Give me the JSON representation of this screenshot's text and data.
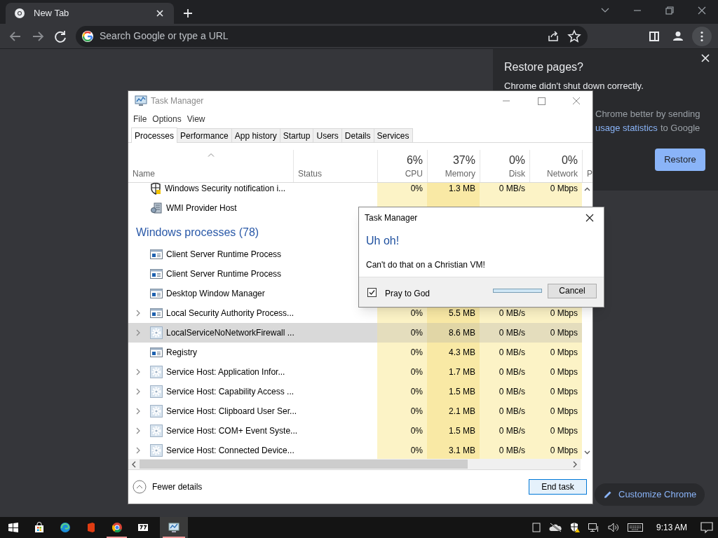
{
  "browser": {
    "tabs": [
      {
        "title": "New Tab",
        "selected": true
      }
    ],
    "omnibox": {
      "placeholder": "Search Google or type a URL"
    },
    "restore_bubble": {
      "title": "Restore pages?",
      "message": "Chrome didn't shut down correctly.",
      "line_1": "Chrome better by sending",
      "link": "usage statistics",
      "line_2_rest": "to Google",
      "button": "Restore"
    },
    "customize_button": "Customize Chrome"
  },
  "task_manager": {
    "title": "Task Manager",
    "menu": [
      "File",
      "Options",
      "View"
    ],
    "tabs": [
      {
        "label": "Processes",
        "selected": true
      },
      {
        "label": "Performance",
        "selected": false
      },
      {
        "label": "App history",
        "selected": false
      },
      {
        "label": "Startup",
        "selected": false
      },
      {
        "label": "Users",
        "selected": false
      },
      {
        "label": "Details",
        "selected": false
      },
      {
        "label": "Services",
        "selected": false
      }
    ],
    "columns": [
      {
        "label": "Name",
        "sorted": true
      },
      {
        "label": "Status",
        "sorted": false
      },
      {
        "summary": "6%",
        "label": "CPU",
        "sorted": false
      },
      {
        "summary": "37%",
        "label": "Memory",
        "sorted": false
      },
      {
        "summary": "0%",
        "label": "Disk",
        "sorted": false
      },
      {
        "summary": "0%",
        "label": "Network",
        "sorted": false
      },
      {
        "label": "P",
        "sorted": false
      }
    ],
    "rows": [
      {
        "kind": "security",
        "name": "Windows Security notification i...",
        "expandable": false,
        "selected": false,
        "values": [
          "0%",
          "1.3 MB",
          "0 MB/s",
          "0 Mbps"
        ]
      },
      {
        "kind": "provider",
        "name": "WMI Provider Host",
        "expandable": false,
        "selected": false
      },
      {
        "kind": "group",
        "name": "Windows processes (78)",
        "selected": false
      },
      {
        "kind": "app",
        "name": "Client Server Runtime Process",
        "expandable": false,
        "selected": false
      },
      {
        "kind": "app",
        "name": "Client Server Runtime Process",
        "expandable": false,
        "selected": false
      },
      {
        "kind": "app",
        "name": "Desktop Window Manager",
        "expandable": false,
        "selected": false
      },
      {
        "kind": "app",
        "name": "Local Security Authority Process...",
        "expandable": true,
        "selected": false,
        "values": [
          "0%",
          "5.5 MB",
          "0 MB/s",
          "0 Mbps"
        ]
      },
      {
        "kind": "service",
        "name": "LocalServiceNoNetworkFirewall ...",
        "expandable": true,
        "selected": true,
        "values": [
          "0%",
          "8.6 MB",
          "0 MB/s",
          "0 Mbps"
        ]
      },
      {
        "kind": "app",
        "name": "Registry",
        "expandable": false,
        "selected": false,
        "values": [
          "0%",
          "4.3 MB",
          "0 MB/s",
          "0 Mbps"
        ]
      },
      {
        "kind": "service",
        "name": "Service Host: Application Infor...",
        "expandable": true,
        "selected": false,
        "values": [
          "0%",
          "1.7 MB",
          "0 MB/s",
          "0 Mbps"
        ]
      },
      {
        "kind": "service",
        "name": "Service Host: Capability Access ...",
        "expandable": true,
        "selected": false,
        "values": [
          "0%",
          "1.5 MB",
          "0 MB/s",
          "0 Mbps"
        ]
      },
      {
        "kind": "service",
        "name": "Service Host: Clipboard User Ser...",
        "expandable": true,
        "selected": false,
        "values": [
          "0%",
          "2.1 MB",
          "0 MB/s",
          "0 Mbps"
        ]
      },
      {
        "kind": "service",
        "name": "Service Host: COM+ Event Syste...",
        "expandable": true,
        "selected": false,
        "values": [
          "0%",
          "1.5 MB",
          "0 MB/s",
          "0 Mbps"
        ]
      },
      {
        "kind": "service",
        "name": "Service Host: Connected Device...",
        "expandable": true,
        "selected": false,
        "values": [
          "0%",
          "3.1 MB",
          "0 MB/s",
          "0 Mbps"
        ]
      }
    ],
    "footer": {
      "fewer_details": "Fewer details",
      "end_task": "End task"
    }
  },
  "dialog": {
    "title": "Task Manager",
    "heading": "Uh oh!",
    "message": "Can't do that on a Christian VM!",
    "checkbox": {
      "label": "Pray to God",
      "checked": true
    },
    "progress": {
      "level": 1
    },
    "button": "Cancel"
  },
  "taskbar": {
    "apps": [
      {
        "kind": "start",
        "running": false,
        "active": false
      },
      {
        "kind": "store",
        "running": false,
        "active": false
      },
      {
        "kind": "edge",
        "running": false,
        "active": false
      },
      {
        "kind": "office",
        "running": false,
        "active": false
      },
      {
        "kind": "chrome",
        "running": true,
        "active": false
      },
      {
        "kind": "archiver",
        "running": false,
        "active": false
      },
      {
        "kind": "taskmgr",
        "running": true,
        "active": true
      }
    ],
    "time": "9:13 AM"
  }
}
